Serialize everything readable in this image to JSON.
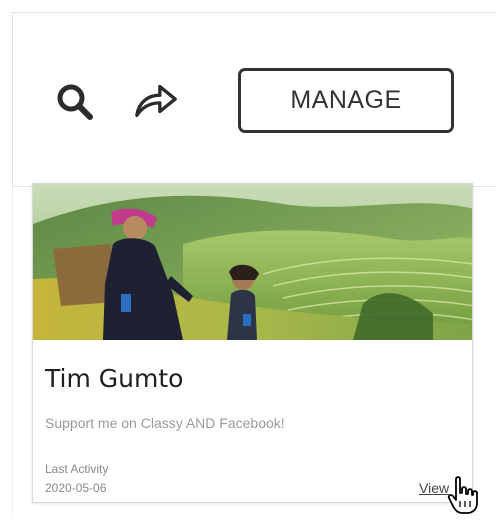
{
  "toolbar": {
    "search_icon": "search-icon",
    "share_icon": "share-icon",
    "manage_label": "MANAGE"
  },
  "card": {
    "name": "Tim Gumto",
    "tagline": "Support me on Classy AND Facebook!",
    "activity_label": "Last Activity",
    "activity_date": "2020-05-06",
    "view_label": "View"
  },
  "colors": {
    "button_border": "#333333",
    "text_primary": "#1f1f1f",
    "text_muted": "#9a9a9a"
  }
}
